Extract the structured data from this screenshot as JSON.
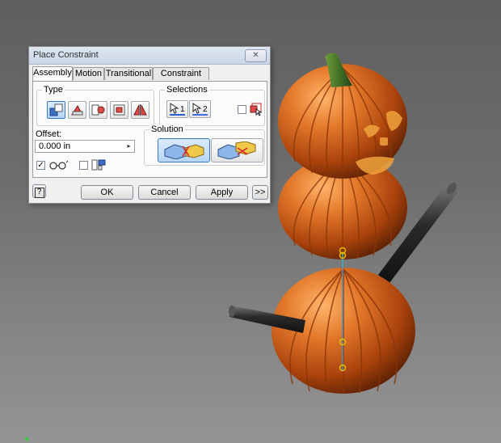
{
  "dialog": {
    "title": "Place Constraint",
    "close_icon": "close-x-icon",
    "tabs": [
      {
        "label": "Assembly",
        "active": true
      },
      {
        "label": "Motion",
        "active": false
      },
      {
        "label": "Transitional",
        "active": false
      },
      {
        "label": "Constraint Set",
        "active": false
      }
    ],
    "type_group": {
      "label": "Type",
      "buttons": [
        {
          "icon": "mate-constraint-icon",
          "selected": true
        },
        {
          "icon": "angle-constraint-icon",
          "selected": false
        },
        {
          "icon": "tangent-constraint-icon",
          "selected": false
        },
        {
          "icon": "insert-constraint-icon",
          "selected": false
        },
        {
          "icon": "symmetry-constraint-icon",
          "selected": false
        }
      ]
    },
    "selections_group": {
      "label": "Selections",
      "first": "1",
      "second": "2",
      "first_color": "#2a5fd8",
      "second_color": "#3e6fe0"
    },
    "offset": {
      "label": "Offset:",
      "value": "0.000 in"
    },
    "solution_group": {
      "label": "Solution",
      "buttons": [
        {
          "icon": "mate-solution-icon",
          "selected": true
        },
        {
          "icon": "flush-solution-icon",
          "selected": false
        }
      ]
    },
    "options": {
      "show_preview_checked": true,
      "predict_offset_checked": false
    },
    "footer": {
      "help_label": "?",
      "ok_label": "OK",
      "cancel_label": "Cancel",
      "apply_label": "Apply",
      "more_label": ">>"
    }
  },
  "scene": {
    "pumpkin_color": "#d9691c",
    "stem_color": "#3f6b25",
    "arm_color": "#2a2a2a",
    "axis_color": "#32b5c7",
    "marker_color": "#e6c200"
  }
}
